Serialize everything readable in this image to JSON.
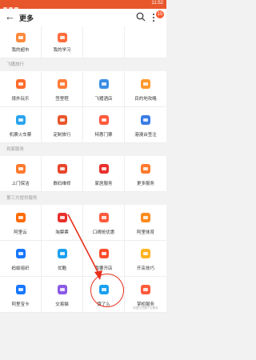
{
  "status": {
    "time": "11:52"
  },
  "header": {
    "title": "更多",
    "badge": "15"
  },
  "sections": [
    {
      "title": "",
      "items": [
        {
          "label": "我的超市",
          "icon": "supermarket-icon",
          "color": "#ff8a3d"
        },
        {
          "label": "我的学习",
          "icon": "study-icon",
          "color": "#ff6d3c"
        }
      ]
    },
    {
      "title": "飞猪旅行",
      "items": [
        {
          "label": "境外玩乐",
          "icon": "overseas-icon",
          "color": "#ff6b2c"
        },
        {
          "label": "签里程",
          "icon": "mileage-icon",
          "color": "#ff7b39"
        },
        {
          "label": "飞猪酒店",
          "icon": "hotel-icon",
          "color": "#3a8ee6"
        },
        {
          "label": "目的地攻略",
          "icon": "destination-icon",
          "color": "#ff9a2e"
        },
        {
          "label": "机票火车票",
          "icon": "plane-icon",
          "color": "#29a4f0"
        },
        {
          "label": "定制旅行",
          "icon": "custom-travel-icon",
          "color": "#e8572b"
        },
        {
          "label": "特惠门票",
          "icon": "ticket-icon",
          "color": "#ff5a3c"
        },
        {
          "label": "港澳台签注",
          "icon": "visa-icon",
          "color": "#3a7de6"
        }
      ]
    },
    {
      "title": "到家服务",
      "items": [
        {
          "label": "上门保洁",
          "icon": "cleaning-icon",
          "color": "#ff7a2e"
        },
        {
          "label": "数码维修",
          "icon": "repair-icon",
          "color": "#e8452b"
        },
        {
          "label": "家居服务",
          "icon": "home-service-icon",
          "color": "#e8302c"
        },
        {
          "label": "更多服务",
          "icon": "more-service-icon",
          "color": "#ff7a2e"
        }
      ]
    },
    {
      "title": "第三方提供服务",
      "items": [
        {
          "label": "阿里云",
          "icon": "aliyun-icon",
          "color": "#ff6a00"
        },
        {
          "label": "淘票票",
          "icon": "taopiaopiao-icon",
          "color": "#e8302c"
        },
        {
          "label": "口碑抢优惠",
          "icon": "koubei-icon",
          "color": "#ff5a3c"
        },
        {
          "label": "阿里体育",
          "icon": "alisports-icon",
          "color": "#ff8a1e"
        },
        {
          "label": "蚂蚁组织",
          "icon": "ant-icon",
          "color": "#1677ff"
        },
        {
          "label": "优酷",
          "icon": "youku-icon",
          "color": "#1aa0f0"
        },
        {
          "label": "我要开店",
          "icon": "open-store-icon",
          "color": "#ff4d2c"
        },
        {
          "label": "开店技巧",
          "icon": "store-tips-icon",
          "color": "#ffb320"
        },
        {
          "label": "阿里宝卡",
          "icon": "alibaoka-icon",
          "color": "#1677ff"
        },
        {
          "label": "交易猫",
          "icon": "jiaoyimao-icon",
          "color": "#8a5be6"
        },
        {
          "label": "饿了么",
          "icon": "eleme-icon",
          "color": "#1aa0f0"
        },
        {
          "label": "掌柜服务",
          "icon": "shopkeeper-icon",
          "color": "#ff5a3c",
          "sub": "阿里巴巴旗下云服务"
        }
      ]
    }
  ]
}
